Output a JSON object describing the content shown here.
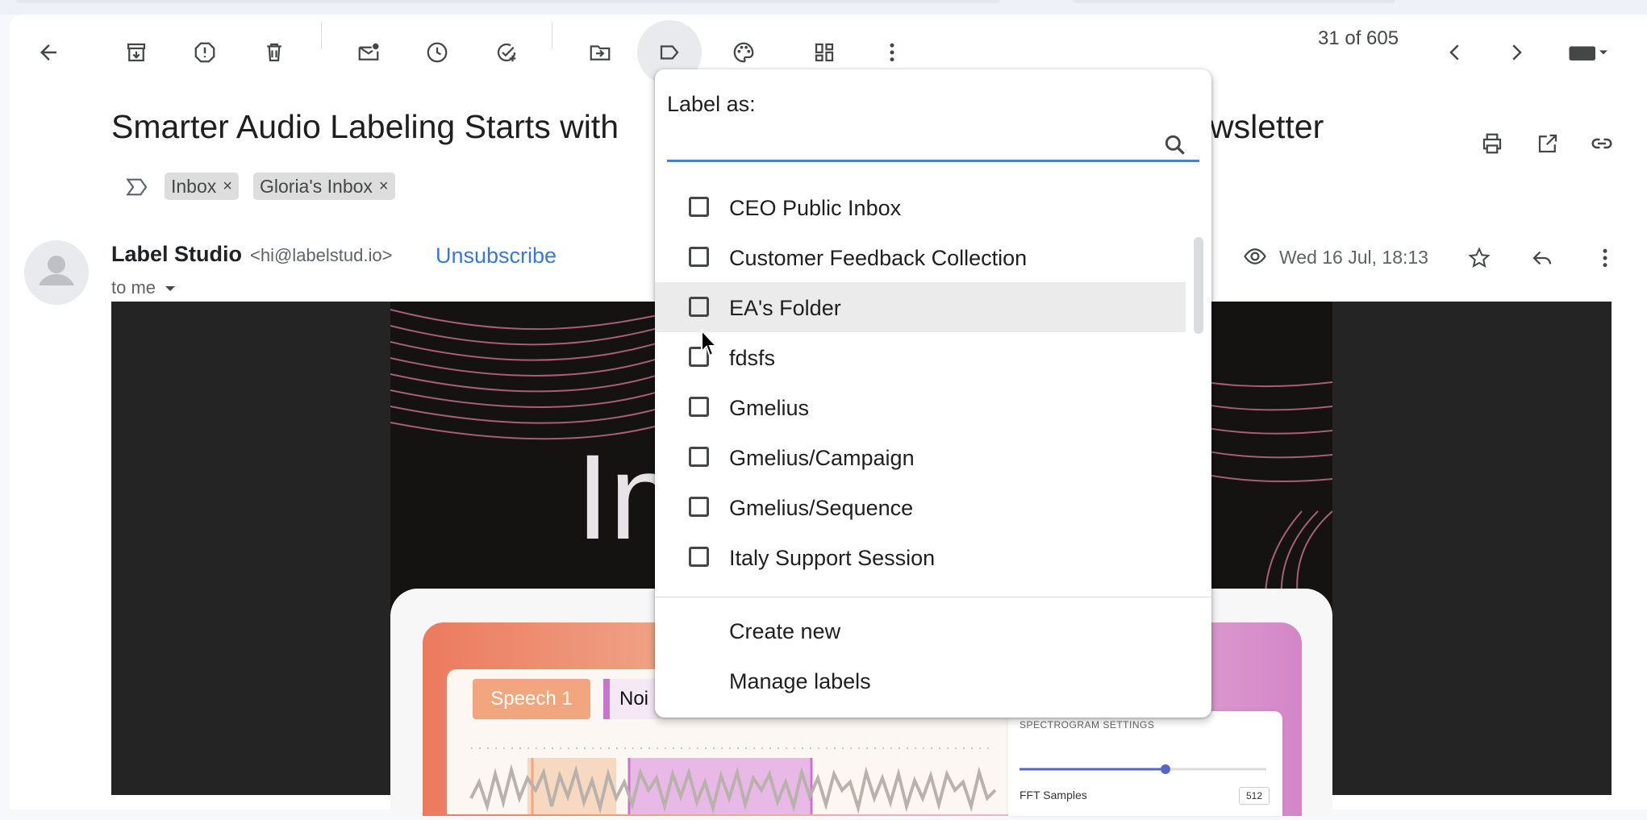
{
  "toolbar": {
    "back": "arrow-left-icon",
    "archive": "archive-icon",
    "report_spam": "report-spam-icon",
    "delete": "trash-icon",
    "mark_unread": "mark-unread-icon",
    "snooze": "clock-icon",
    "add_task": "add-task-icon",
    "move_to": "move-to-icon",
    "labels": "label-icon",
    "extension": "palette-icon",
    "apps": "apps-icon",
    "more": "more-vert-icon",
    "pager": "31 of 605"
  },
  "email": {
    "subject_start": "Smarter Audio Labeling Starts with",
    "subject_end": "wsletter",
    "chips": [
      {
        "label": "Inbox"
      },
      {
        "label": "Gloria's Inbox"
      }
    ],
    "chip_remove": "×",
    "sender_name": "Label Studio",
    "sender_email": "<hi@labelstud.io>",
    "unsubscribe": "Unsubscribe",
    "to": "to me",
    "date": "Wed 16 Jul, 18:13"
  },
  "hero": {
    "big_text": "In",
    "speech_chip": "Speech 1",
    "noise_chip": "Noi",
    "spec_title": "SPECTROGRAM SETTINGS",
    "fft_label": "FFT Samples",
    "fft_value": "512"
  },
  "label_menu": {
    "title": "Label as:",
    "search_placeholder": "",
    "labels": [
      "CEO Public Inbox",
      "Customer Feedback Collection",
      "EA's Folder",
      "fdsfs",
      "Gmelius",
      "Gmelius/Campaign",
      "Gmelius/Sequence",
      "Italy Support Session"
    ],
    "hovered_index": 2,
    "create_new": "Create new",
    "manage_labels": "Manage labels"
  },
  "colors": {
    "accent_blue": "#3b78d4",
    "search_underline": "#4a7fd6",
    "speech_chip": "#f2a67e",
    "noise_bar": "#c777c9"
  }
}
